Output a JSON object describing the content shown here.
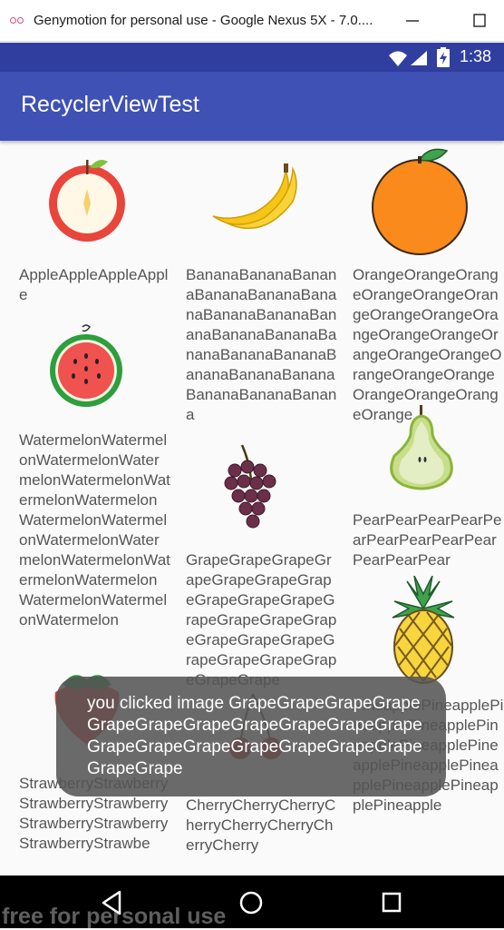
{
  "window": {
    "title": "Genymotion for personal use - Google Nexus 5X - 7.0....",
    "logo_icon": "genymotion-logo-icon",
    "minimize_icon": "minimize-icon",
    "maximize_icon": "maximize-icon"
  },
  "status_bar": {
    "time": "1:38",
    "icons": [
      "wifi-icon",
      "signal-icon",
      "battery-charging-icon"
    ]
  },
  "app_bar": {
    "title": "RecyclerViewTest"
  },
  "grid": {
    "items": [
      {
        "name": "AppleAppleAppleApple",
        "image": "apple-icon"
      },
      {
        "name": "BananaBananaBananaBananaBananaBananaBananaBananaBananaBananaBananaBananaBananaBananaBananaBananaBananaBananaBananaBanana",
        "image": "banana-icon"
      },
      {
        "name": "OrangeOrangeOrangeOrangeOrangeOrangeOrangeOrangeOrangeOrangeOrangeOrangeOrangeOrangeOrangeOrangeOrangeOrangeOrangeOrangeOrange",
        "image": "orange-icon"
      },
      {
        "name": "WatermelonWatermelonWatermelonWatermelonWatermelonWatermelonWatermelonWatermelonWatermelonWatermelonWatermelonWatermelonWatermelonWatermelonWatermelonWatermelonWatermelon",
        "image": "watermelon-icon"
      },
      {
        "name": "GrapeGrapeGrapeGrapeGrapeGrapeGrapeGrapeGrapeGrapeGrapeGrapeGrapeGrapeGrapeGrapeGrapeGrapeGrapeGrapeGrapeGrapeGrape",
        "image": "grape-icon"
      },
      {
        "name": "PearPearPearPearPearPearPearPearPearPearPearPear",
        "image": "pear-icon"
      },
      {
        "name": "StrawberryStrawberryStrawberryStrawberryStrawberryStrawberryStrawberryStrawbe",
        "image": "strawberry-icon"
      },
      {
        "name": "CherryCherryCherryCherryCherryCherryCherryCherry",
        "image": "cherry-icon"
      },
      {
        "name": "PineapplePineapplePineapplePineapplePineapplePineapplePineapplePineapplePineapplePineapplePineapplePineapple",
        "image": "pineapple-icon"
      }
    ]
  },
  "toast": {
    "message": "you clicked image GrapeGrapeGrapeGrapeGrapeGrapeGrapeGrapeGrapeGrapeGrapeGrapeGrapeGrapeGrapeGrapeGrapeGrapeGrapeGrape"
  },
  "nav_bar": {
    "icons": [
      "back-icon",
      "home-icon",
      "recents-icon"
    ]
  },
  "watermark": {
    "text": "free for personal use"
  }
}
